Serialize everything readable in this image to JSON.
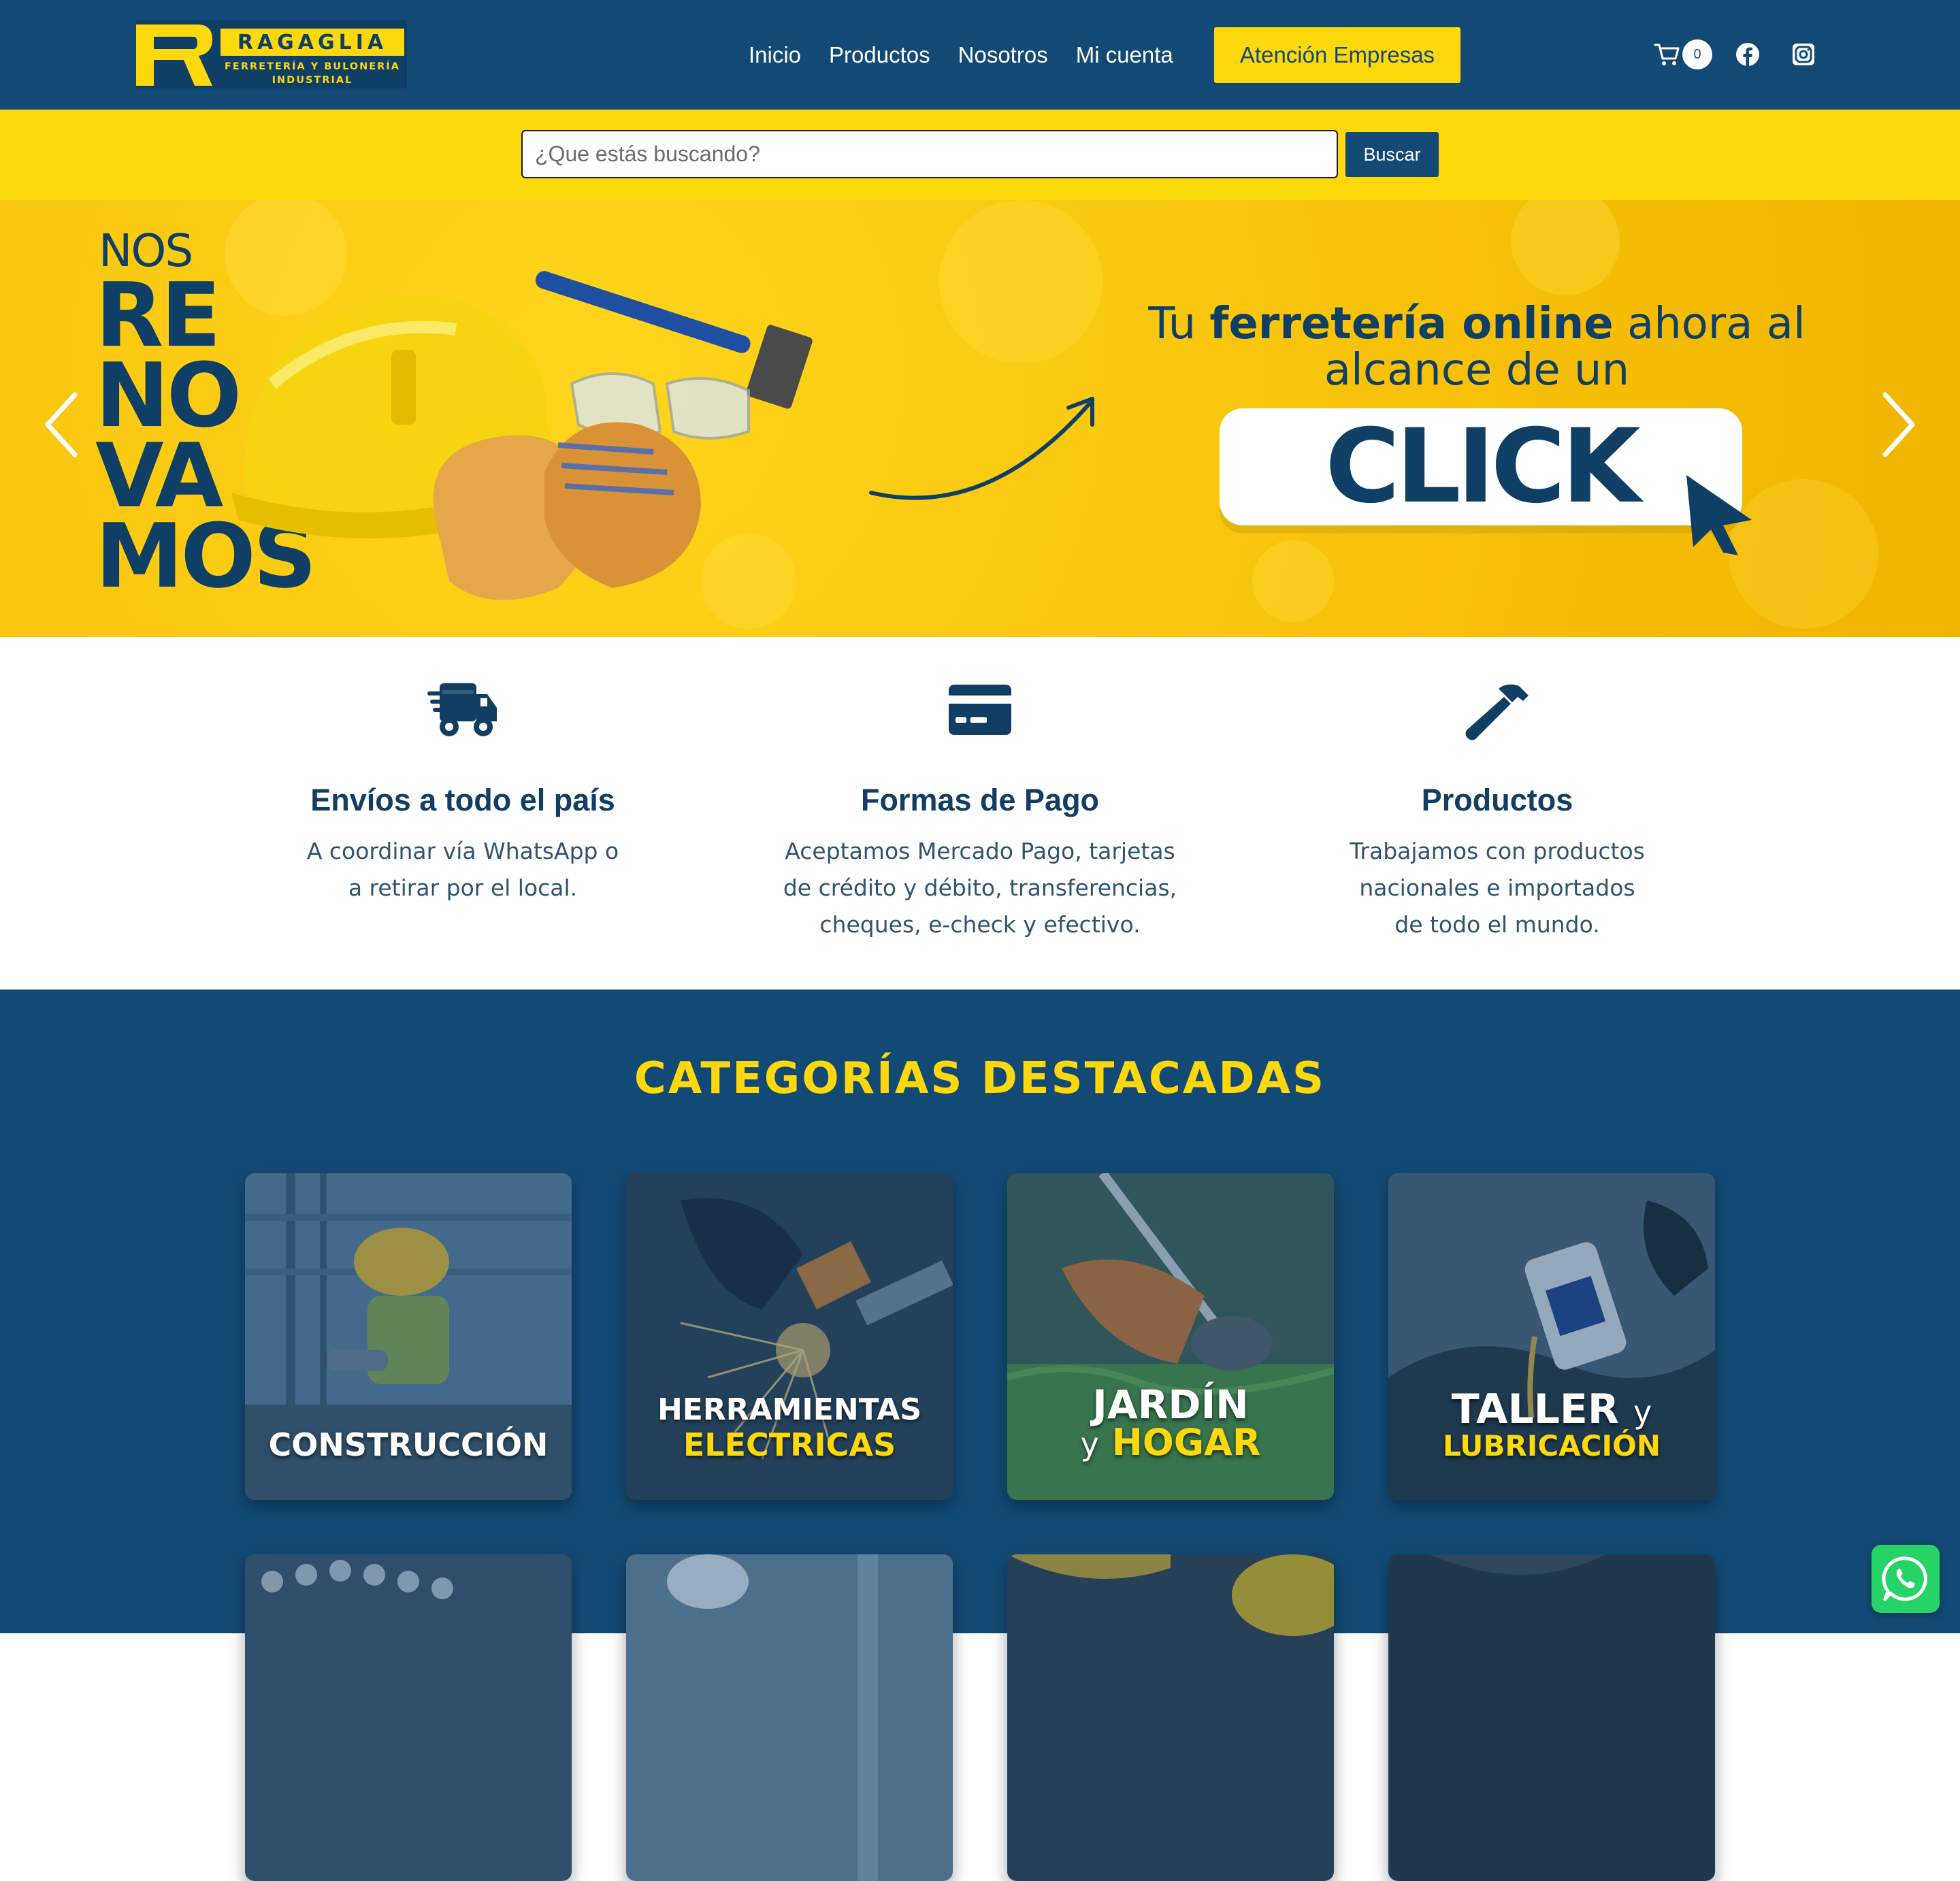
{
  "brand": {
    "name": "RAGAGLIA",
    "subtitle_line1": "FERRETERÍA Y BULONERÍA",
    "subtitle_line2": "INDUSTRIAL"
  },
  "nav": {
    "items": [
      "Inicio",
      "Productos",
      "Nosotros",
      "Mi cuenta"
    ],
    "cta": "Atención Empresas",
    "cart_count": "0"
  },
  "search": {
    "placeholder": "¿Que estás buscando?",
    "button": "Buscar"
  },
  "hero": {
    "nos": "NOS",
    "renovamos": [
      "RE",
      "NO",
      "VA",
      "MOS"
    ],
    "tagline_pre": "Tu ",
    "tagline_bold": "ferretería online",
    "tagline_post": " ahora al",
    "tagline_line2": "alcance de un",
    "click": "CLICK"
  },
  "features": [
    {
      "icon": "truck-icon",
      "title": "Envíos a todo el país",
      "text_lines": [
        "A coordinar vía WhatsApp o",
        "a retirar por el local."
      ]
    },
    {
      "icon": "credit-card-icon",
      "title": "Formas de Pago",
      "text_lines": [
        "Aceptamos Mercado Pago, tarjetas",
        "de crédito y débito, transferencias,",
        "cheques, e-check y efectivo."
      ]
    },
    {
      "icon": "hammer-icon",
      "title": "Productos",
      "text_lines": [
        "Trabajamos con productos",
        "nacionales e importados",
        "de todo el mundo."
      ]
    }
  ],
  "categories": {
    "title": "CATEGORÍAS DESTACADAS",
    "cards": [
      {
        "line1": "CONSTRUCCIÓN"
      },
      {
        "line1": "HERRAMIENTAS",
        "line2": "ELECTRICAS"
      },
      {
        "line1": "JARDÍN",
        "connector": "y",
        "line2": "HOGAR"
      },
      {
        "line1": "TALLER",
        "connector": "y",
        "line2": "LUBRICACIÓN"
      }
    ]
  },
  "colors": {
    "navy": "#134a75",
    "yellow": "#fcd80c",
    "whatsapp": "#25d366"
  }
}
